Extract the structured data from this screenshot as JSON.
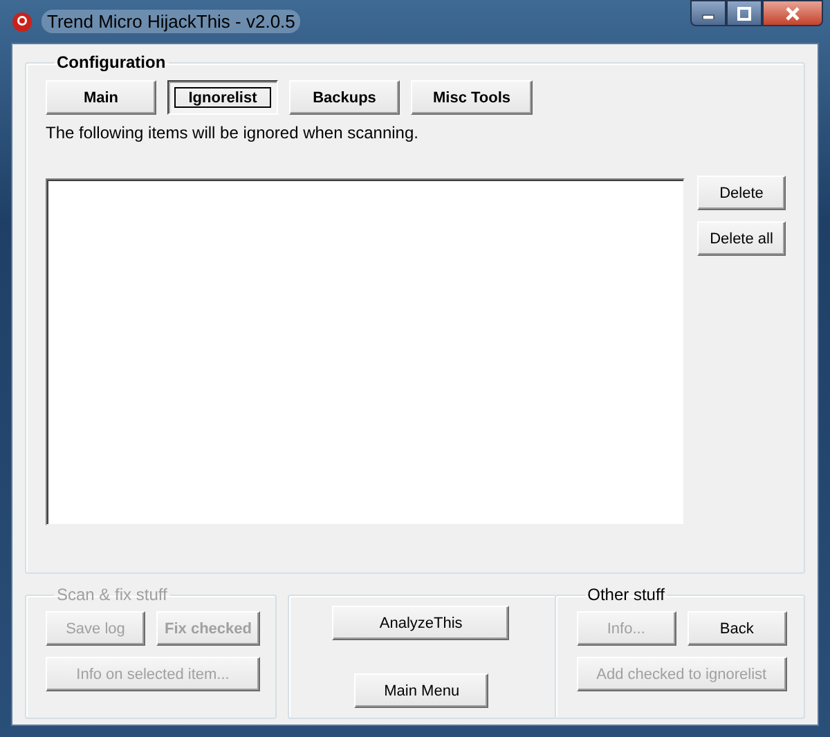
{
  "window": {
    "title": "Trend Micro HijackThis - v2.0.5"
  },
  "configuration": {
    "title": "Configuration",
    "tabs": [
      {
        "label": "Main",
        "selected": false
      },
      {
        "label": "Ignorelist",
        "selected": true
      },
      {
        "label": "Backups",
        "selected": false
      },
      {
        "label": "Misc Tools",
        "selected": false
      }
    ],
    "description": "The following items will be ignored when scanning.",
    "buttons": [
      {
        "label": "Delete",
        "disabled": false
      },
      {
        "label": "Delete all",
        "disabled": false
      }
    ]
  },
  "scan_fix": {
    "title": "Scan & fix stuff",
    "disabled": true,
    "buttons": [
      {
        "label": "Save log",
        "disabled": true,
        "bold": false
      },
      {
        "label": "Fix checked",
        "disabled": true,
        "bold": true
      },
      {
        "label": "Info on selected item...",
        "disabled": true,
        "bold": false
      }
    ]
  },
  "middle": {
    "buttons": [
      {
        "label": "AnalyzeThis",
        "disabled": false
      },
      {
        "label": "Main Menu",
        "disabled": false
      }
    ]
  },
  "other_stuff": {
    "title": "Other stuff",
    "disabled": false,
    "buttons": [
      {
        "label": "Info...",
        "disabled": true
      },
      {
        "label": "Back",
        "disabled": false
      },
      {
        "label": "Add checked to ignorelist",
        "disabled": true
      }
    ]
  }
}
